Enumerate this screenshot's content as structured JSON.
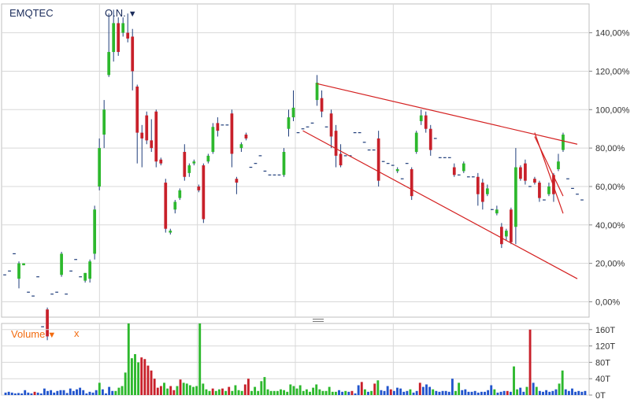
{
  "header": {
    "ticker": "EMQTEC",
    "mode_label": "O.N.",
    "mode_caret": "▼"
  },
  "volume_panel": {
    "label": "Volume",
    "caret": "▼",
    "close": "x"
  },
  "colors": {
    "up": "#2db82d",
    "down": "#c8202a",
    "neutral": "#1f3d7a",
    "trendline": "#d42020",
    "grid": "#d8d8d8",
    "vol_blue": "#2255cc"
  },
  "chart_data": [
    {
      "type": "candlestick",
      "title": "",
      "y_ticks": [
        "140,00%",
        "120,00%",
        "100,00%",
        "80,00%",
        "60,00%",
        "40,00%",
        "20,00%",
        "0,00%"
      ],
      "ylim": [
        -8,
        155
      ],
      "grid": true,
      "candles": [
        [
          14,
          14,
          14,
          14
        ],
        [
          16,
          16,
          16,
          16
        ],
        [
          25,
          25,
          25,
          25
        ],
        [
          12,
          20,
          21,
          7
        ],
        [
          19,
          20,
          20,
          19
        ],
        [
          5,
          5,
          5,
          5
        ],
        [
          3,
          3,
          3,
          3
        ],
        [
          13,
          13,
          13,
          13
        ],
        [
          -13,
          -13,
          -13,
          -13
        ],
        [
          -4,
          -18,
          -3,
          -20
        ],
        [
          4,
          4,
          4,
          4
        ],
        [
          5,
          5,
          5,
          5
        ],
        [
          14,
          25,
          26,
          13
        ],
        [
          4,
          4,
          4,
          4
        ],
        [
          16,
          16,
          16,
          16
        ],
        [
          22,
          22,
          22,
          22
        ],
        [
          13,
          13,
          13,
          13
        ],
        [
          11,
          15,
          15,
          10
        ],
        [
          12,
          21,
          22,
          10
        ],
        [
          25,
          48,
          50,
          22
        ],
        [
          60,
          80,
          85,
          58
        ],
        [
          87,
          100,
          105,
          80
        ],
        [
          118,
          130,
          150,
          117
        ],
        [
          130,
          145,
          152,
          125
        ],
        [
          145,
          130,
          148,
          128
        ],
        [
          140,
          145,
          148,
          138
        ],
        [
          140,
          137,
          150,
          135
        ],
        [
          138,
          120,
          142,
          110
        ],
        [
          112,
          88,
          113,
          72
        ],
        [
          88,
          85,
          92,
          70
        ],
        [
          97,
          84,
          99,
          82
        ],
        [
          84,
          80,
          95,
          78
        ],
        [
          99,
          73,
          100,
          70
        ],
        [
          74,
          72,
          75,
          71
        ],
        [
          62,
          38,
          64,
          36
        ],
        [
          36,
          37,
          38,
          35
        ],
        [
          48,
          52,
          53,
          46
        ],
        [
          54,
          58,
          59,
          53
        ],
        [
          78,
          65,
          82,
          63
        ],
        [
          67,
          71,
          72,
          65
        ],
        [
          72,
          73,
          74,
          71
        ],
        [
          60,
          58,
          61,
          57
        ],
        [
          71,
          43,
          72,
          41
        ],
        [
          73,
          76,
          77,
          72
        ],
        [
          78,
          91,
          93,
          77
        ],
        [
          93,
          89,
          96,
          86
        ],
        [
          92,
          92,
          92,
          92
        ],
        [
          92,
          92,
          92,
          92
        ],
        [
          98,
          77,
          100,
          70
        ],
        [
          64,
          62,
          65,
          56
        ],
        [
          80,
          82,
          83,
          78
        ],
        [
          87,
          85,
          88,
          84
        ],
        [
          70,
          70,
          70,
          70
        ],
        [
          72,
          72,
          72,
          72
        ],
        [
          76,
          76,
          76,
          76
        ],
        [
          68,
          68,
          68,
          68
        ],
        [
          66,
          66,
          66,
          66
        ],
        [
          66,
          66,
          66,
          66
        ],
        [
          66,
          66,
          66,
          66
        ],
        [
          66,
          78,
          80,
          65
        ],
        [
          90,
          96,
          100,
          86
        ],
        [
          96,
          101,
          110,
          94
        ],
        [
          88,
          88,
          88,
          88
        ],
        [
          90,
          90,
          90,
          90
        ],
        [
          91,
          91,
          91,
          91
        ],
        [
          93,
          93,
          93,
          93
        ],
        [
          105,
          114,
          118,
          102
        ],
        [
          106,
          99,
          110,
          96
        ],
        [
          91,
          91,
          91,
          91
        ],
        [
          98,
          86,
          100,
          80
        ],
        [
          89,
          76,
          92,
          70
        ],
        [
          77,
          71,
          82,
          70
        ],
        [
          76,
          76,
          76,
          76
        ],
        [
          76,
          76,
          76,
          76
        ],
        [
          88,
          88,
          88,
          88
        ],
        [
          88,
          88,
          88,
          88
        ],
        [
          83,
          83,
          83,
          83
        ],
        [
          79,
          79,
          79,
          79
        ],
        [
          79,
          79,
          79,
          79
        ],
        [
          85,
          63,
          89,
          60
        ],
        [
          73,
          73,
          73,
          73
        ],
        [
          72,
          72,
          72,
          72
        ],
        [
          71,
          71,
          71,
          71
        ],
        [
          68,
          69,
          70,
          67
        ],
        [
          64,
          64,
          64,
          64
        ],
        [
          72,
          72,
          72,
          72
        ],
        [
          69,
          55,
          70,
          53
        ],
        [
          78,
          88,
          89,
          77
        ],
        [
          94,
          97,
          100,
          92
        ],
        [
          97,
          90,
          99,
          88
        ],
        [
          90,
          79,
          92,
          76
        ],
        [
          85,
          85,
          85,
          85
        ],
        [
          75,
          75,
          75,
          75
        ],
        [
          75,
          75,
          75,
          75
        ],
        [
          75,
          75,
          75,
          75
        ],
        [
          70,
          66,
          72,
          65
        ],
        [
          66,
          66,
          66,
          66
        ],
        [
          68,
          72,
          73,
          67
        ],
        [
          65,
          65,
          65,
          65
        ],
        [
          65,
          65,
          65,
          65
        ],
        [
          65,
          56,
          67,
          50
        ],
        [
          62,
          52,
          64,
          48
        ],
        [
          56,
          59,
          61,
          55
        ],
        [
          48,
          48,
          48,
          48
        ],
        [
          46,
          48,
          50,
          45
        ],
        [
          39,
          30,
          41,
          28
        ],
        [
          34,
          37,
          38,
          32
        ],
        [
          48,
          31,
          49,
          30
        ],
        [
          39,
          70,
          80,
          30
        ],
        [
          70,
          64,
          71,
          63
        ],
        [
          72,
          63,
          74,
          61
        ],
        [
          60,
          60,
          60,
          60
        ],
        [
          64,
          62,
          65,
          61
        ],
        [
          62,
          54,
          63,
          52
        ],
        [
          53,
          53,
          53,
          53
        ],
        [
          56,
          60,
          62,
          55
        ],
        [
          66,
          56,
          67,
          52
        ],
        [
          69,
          73,
          77,
          68
        ],
        [
          79,
          87,
          88,
          78
        ],
        [
          64,
          64,
          64,
          64
        ],
        [
          59,
          59,
          59,
          59
        ],
        [
          56,
          56,
          56,
          56
        ],
        [
          53,
          53,
          53,
          53
        ]
      ],
      "volume_ticks": [
        "160T",
        "120T",
        "80T",
        "40T",
        "0T"
      ],
      "volume_ylim": [
        0,
        175
      ],
      "volume": [
        [
          6,
          "b"
        ],
        [
          8,
          "b"
        ],
        [
          6,
          "b"
        ],
        [
          4,
          "b"
        ],
        [
          5,
          "b"
        ],
        [
          4,
          "b"
        ],
        [
          12,
          "b"
        ],
        [
          6,
          "b"
        ],
        [
          4,
          "b"
        ],
        [
          8,
          "r"
        ],
        [
          6,
          "b"
        ],
        [
          4,
          "b"
        ],
        [
          16,
          "b"
        ],
        [
          10,
          "b"
        ],
        [
          12,
          "b"
        ],
        [
          6,
          "b"
        ],
        [
          10,
          "b"
        ],
        [
          12,
          "b"
        ],
        [
          12,
          "b"
        ],
        [
          5,
          "b"
        ],
        [
          16,
          "b"
        ],
        [
          10,
          "b"
        ],
        [
          14,
          "b"
        ],
        [
          18,
          "b"
        ],
        [
          12,
          "b"
        ],
        [
          4,
          "b"
        ],
        [
          8,
          "b"
        ],
        [
          6,
          "b"
        ],
        [
          12,
          "b"
        ],
        [
          30,
          "g"
        ],
        [
          14,
          "b"
        ],
        [
          4,
          "b"
        ],
        [
          20,
          "b"
        ],
        [
          10,
          "b"
        ],
        [
          10,
          "g"
        ],
        [
          18,
          "g"
        ],
        [
          22,
          "g"
        ],
        [
          55,
          "g"
        ],
        [
          175,
          "g"
        ],
        [
          90,
          "g"
        ],
        [
          100,
          "g"
        ],
        [
          80,
          "g"
        ],
        [
          92,
          "r"
        ],
        [
          88,
          "r"
        ],
        [
          72,
          "r"
        ],
        [
          60,
          "r"
        ],
        [
          40,
          "r"
        ],
        [
          18,
          "r"
        ],
        [
          22,
          "r"
        ],
        [
          30,
          "g"
        ],
        [
          16,
          "g"
        ],
        [
          22,
          "r"
        ],
        [
          12,
          "r"
        ],
        [
          22,
          "g"
        ],
        [
          38,
          "r"
        ],
        [
          30,
          "g"
        ],
        [
          28,
          "g"
        ],
        [
          24,
          "g"
        ],
        [
          20,
          "g"
        ],
        [
          22,
          "g"
        ],
        [
          196,
          "g"
        ],
        [
          28,
          "g"
        ],
        [
          14,
          "g"
        ],
        [
          10,
          "g"
        ],
        [
          16,
          "r"
        ],
        [
          10,
          "g"
        ],
        [
          14,
          "g"
        ],
        [
          16,
          "r"
        ],
        [
          10,
          "g"
        ],
        [
          20,
          "r"
        ],
        [
          10,
          "g"
        ],
        [
          24,
          "g"
        ],
        [
          12,
          "g"
        ],
        [
          10,
          "g"
        ],
        [
          26,
          "r"
        ],
        [
          40,
          "r"
        ],
        [
          10,
          "g"
        ],
        [
          20,
          "g"
        ],
        [
          10,
          "g"
        ],
        [
          34,
          "g"
        ],
        [
          44,
          "g"
        ],
        [
          14,
          "g"
        ],
        [
          10,
          "g"
        ],
        [
          10,
          "g"
        ],
        [
          10,
          "g"
        ],
        [
          14,
          "g"
        ],
        [
          12,
          "g"
        ],
        [
          8,
          "g"
        ],
        [
          26,
          "g"
        ],
        [
          22,
          "g"
        ],
        [
          16,
          "g"
        ],
        [
          24,
          "g"
        ],
        [
          10,
          "g"
        ],
        [
          14,
          "g"
        ],
        [
          8,
          "g"
        ],
        [
          18,
          "g"
        ],
        [
          26,
          "g"
        ],
        [
          14,
          "g"
        ],
        [
          10,
          "g"
        ],
        [
          10,
          "g"
        ],
        [
          20,
          "g"
        ],
        [
          8,
          "g"
        ],
        [
          8,
          "g"
        ],
        [
          12,
          "b"
        ],
        [
          8,
          "b"
        ],
        [
          10,
          "g"
        ],
        [
          8,
          "b"
        ],
        [
          10,
          "r"
        ],
        [
          4,
          "b"
        ],
        [
          24,
          "b"
        ],
        [
          32,
          "r"
        ],
        [
          14,
          "g"
        ],
        [
          8,
          "b"
        ],
        [
          10,
          "g"
        ],
        [
          28,
          "r"
        ],
        [
          36,
          "g"
        ],
        [
          12,
          "b"
        ],
        [
          10,
          "b"
        ],
        [
          22,
          "b"
        ],
        [
          14,
          "r"
        ],
        [
          10,
          "b"
        ],
        [
          18,
          "b"
        ],
        [
          16,
          "b"
        ],
        [
          8,
          "b"
        ],
        [
          10,
          "b"
        ],
        [
          14,
          "g"
        ],
        [
          6,
          "b"
        ],
        [
          10,
          "b"
        ],
        [
          30,
          "r"
        ],
        [
          20,
          "b"
        ],
        [
          26,
          "b"
        ],
        [
          20,
          "b"
        ],
        [
          14,
          "g"
        ],
        [
          10,
          "b"
        ],
        [
          8,
          "b"
        ],
        [
          10,
          "b"
        ],
        [
          10,
          "b"
        ],
        [
          8,
          "b"
        ],
        [
          40,
          "b"
        ],
        [
          10,
          "g"
        ],
        [
          30,
          "g"
        ],
        [
          12,
          "b"
        ],
        [
          14,
          "b"
        ],
        [
          8,
          "b"
        ],
        [
          8,
          "b"
        ],
        [
          10,
          "b"
        ],
        [
          6,
          "b"
        ],
        [
          8,
          "b"
        ],
        [
          8,
          "b"
        ],
        [
          12,
          "b"
        ],
        [
          24,
          "b"
        ],
        [
          14,
          "g"
        ],
        [
          6,
          "b"
        ],
        [
          8,
          "b"
        ],
        [
          10,
          "b"
        ],
        [
          10,
          "r"
        ],
        [
          8,
          "b"
        ],
        [
          70,
          "g"
        ],
        [
          14,
          "g"
        ],
        [
          18,
          "b"
        ],
        [
          8,
          "b"
        ],
        [
          20,
          "g"
        ],
        [
          160,
          "r"
        ],
        [
          30,
          "b"
        ],
        [
          20,
          "g"
        ],
        [
          10,
          "b"
        ],
        [
          8,
          "b"
        ],
        [
          12,
          "b"
        ],
        [
          8,
          "b"
        ],
        [
          10,
          "b"
        ],
        [
          14,
          "b"
        ],
        [
          28,
          "g"
        ],
        [
          60,
          "g"
        ],
        [
          14,
          "b"
        ],
        [
          10,
          "b"
        ],
        [
          16,
          "b"
        ],
        [
          8,
          "b"
        ],
        [
          10,
          "b"
        ],
        [
          8,
          "b"
        ],
        [
          10,
          "b"
        ]
      ]
    }
  ]
}
